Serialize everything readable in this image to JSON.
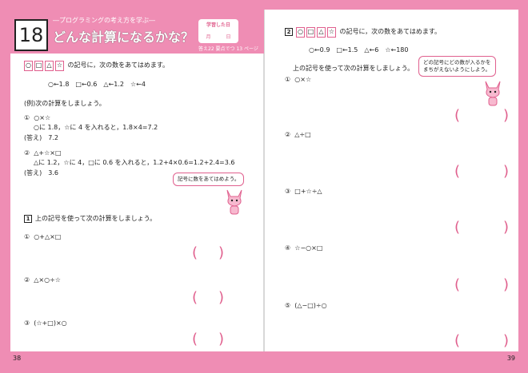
{
  "header": {
    "number": "18",
    "subtitle": "―プログラミングの考え方を学ぶ―",
    "title": "どんな計算になるかな？",
    "date_label": "学習した日",
    "month": "月",
    "day": "日",
    "ref": "答え22 要点でつ 13 ページ"
  },
  "left": {
    "intro_syms": [
      "○",
      "□",
      "△",
      "☆"
    ],
    "intro_text": "の記号に，次の数をあてはめます。",
    "values": "○←1.8　□←0.6　△←1.2　☆←4",
    "example_title": "(例)次の計算をしましょう。",
    "ex1_num": "①",
    "ex1_expr": "○×☆",
    "ex1_work": "○に 1.8，☆に 4 を入れると，1.8×4=7.2",
    "ex1_ans": "(答え)　7.2",
    "ex2_num": "②",
    "ex2_expr": "△+☆×□",
    "ex2_work": "△に 1.2，☆に 4，□に 0.6 を入れると，1.2+4×0.6=1.2+2.4=3.6",
    "ex2_ans": "(答え)　3.6",
    "bubble": "記号に数をあてはめよう。",
    "q_num": "1",
    "q_title": "上の記号を使って次の計算をしましょう。",
    "items": [
      {
        "n": "①",
        "expr": "○+△×□"
      },
      {
        "n": "②",
        "expr": "△×○÷☆"
      },
      {
        "n": "③",
        "expr": "(☆+□)×○"
      }
    ],
    "page_number": "38"
  },
  "right": {
    "q_num": "2",
    "intro_syms": [
      "○",
      "□",
      "△",
      "☆"
    ],
    "intro_text": "の記号に，次の数をあてはめます。",
    "values": "○←0.9　□←1.5　△←6　☆←180",
    "q_title": "上の記号を使って次の計算をしましょう。",
    "bubble_line1": "どの記号にどの数が入るかを",
    "bubble_line2": "まちがえないようにしよう。",
    "items": [
      {
        "n": "①",
        "expr": "○×☆"
      },
      {
        "n": "②",
        "expr": "△÷□"
      },
      {
        "n": "③",
        "expr": "□+☆÷△"
      },
      {
        "n": "④",
        "expr": "☆−○×□"
      },
      {
        "n": "⑤",
        "expr": "(△−□)÷○"
      }
    ],
    "page_number": "39"
  },
  "colors": {
    "accent": "#ef8db4",
    "accent_dark": "#e0608e"
  }
}
